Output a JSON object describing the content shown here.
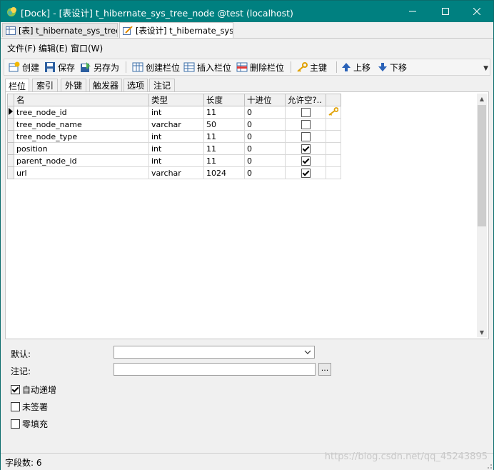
{
  "window": {
    "title": "[Dock] - [表设计] t_hibernate_sys_tree_node @test (localhost)",
    "accent": "#008080"
  },
  "doc_tabs": [
    {
      "label": "[表] t_hibernate_sys_tree...",
      "icon": "table-icon",
      "active": false
    },
    {
      "label": "[表设计] t_hibernate_sys...",
      "icon": "design-pencil-icon",
      "active": true
    }
  ],
  "menu": [
    "文件(F)",
    "编辑(E)",
    "窗口(W)"
  ],
  "toolbar": {
    "create": "创建",
    "save": "保存",
    "save_as": "另存为",
    "add_field": "创建栏位",
    "insert_field": "插入栏位",
    "delete_field": "删除栏位",
    "primary_key": "主键",
    "move_up": "上移",
    "move_down": "下移"
  },
  "sub_tabs": [
    "栏位",
    "索引",
    "外键",
    "触发器",
    "选项",
    "注记"
  ],
  "grid": {
    "headers": [
      "名",
      "类型",
      "长度",
      "十进位",
      "允许空?..",
      ""
    ],
    "rows": [
      {
        "name": "tree_node_id",
        "type": "int",
        "length": "11",
        "decimals": "0",
        "nullable": false,
        "key": true,
        "current": true
      },
      {
        "name": "tree_node_name",
        "type": "varchar",
        "length": "50",
        "decimals": "0",
        "nullable": false,
        "key": false,
        "current": false
      },
      {
        "name": "tree_node_type",
        "type": "int",
        "length": "11",
        "decimals": "0",
        "nullable": false,
        "key": false,
        "current": false
      },
      {
        "name": "position",
        "type": "int",
        "length": "11",
        "decimals": "0",
        "nullable": true,
        "key": false,
        "current": false
      },
      {
        "name": "parent_node_id",
        "type": "int",
        "length": "11",
        "decimals": "0",
        "nullable": true,
        "key": false,
        "current": false
      },
      {
        "name": "url",
        "type": "varchar",
        "length": "1024",
        "decimals": "0",
        "nullable": true,
        "key": false,
        "current": false
      }
    ]
  },
  "props": {
    "default_label": "默认:",
    "default_value": "",
    "comment_label": "注记:",
    "comment_value": "",
    "ellipsis": "...",
    "auto_increment": {
      "label": "自动递增",
      "checked": true
    },
    "unsigned": {
      "label": "未签署",
      "checked": false
    },
    "zerofill": {
      "label": "零填充",
      "checked": false
    }
  },
  "status": {
    "field_count": "字段数: 6",
    "watermark": "https://blog.csdn.net/qq_45243895"
  }
}
